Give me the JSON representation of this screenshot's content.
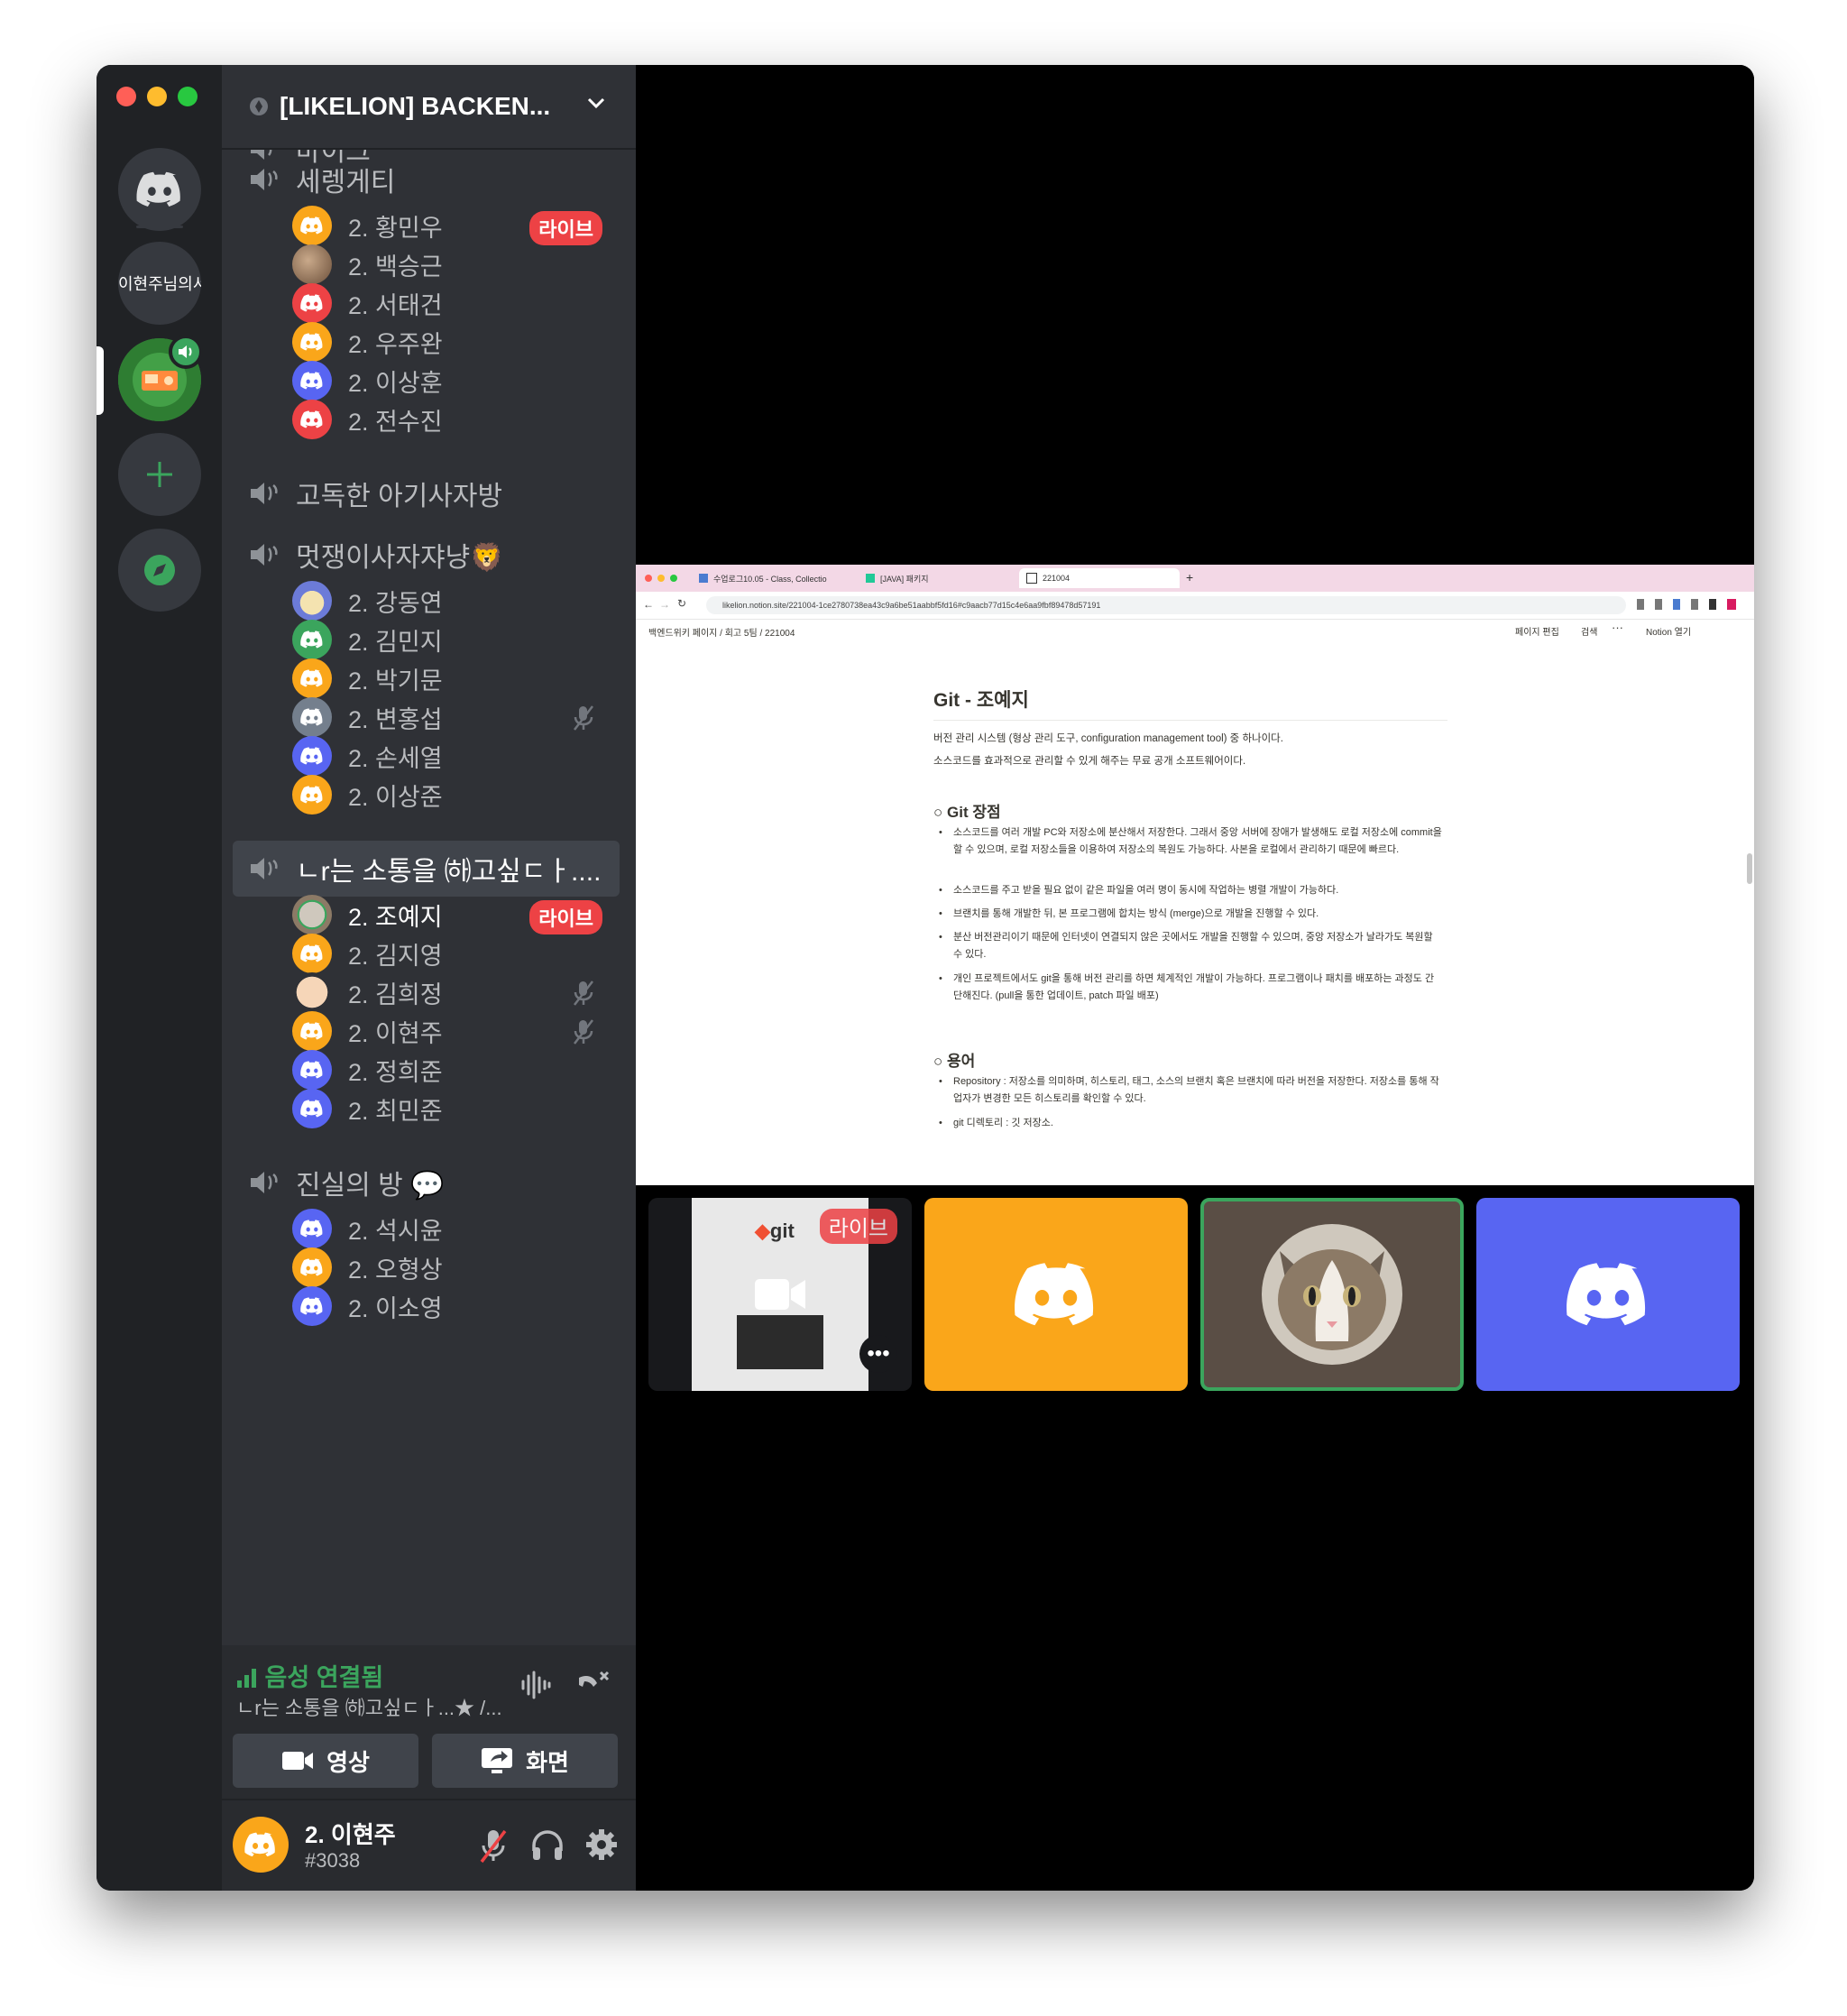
{
  "guild": {
    "name": "[LIKELION] BACKEN...",
    "partial_channel": "마이크"
  },
  "rail": {
    "server_label": "이현주님의서"
  },
  "channels": [
    {
      "name": "세렝게티",
      "users": [
        {
          "name": "2. 황민우",
          "avatar": "orange",
          "live": true,
          "muted": false
        },
        {
          "name": "2. 백승근",
          "avatar": "photo-brown",
          "live": false,
          "muted": false
        },
        {
          "name": "2. 서태건",
          "avatar": "red",
          "live": false,
          "muted": false
        },
        {
          "name": "2. 우주완",
          "avatar": "orange",
          "live": false,
          "muted": false
        },
        {
          "name": "2. 이상훈",
          "avatar": "blurple",
          "live": false,
          "muted": false
        },
        {
          "name": "2. 전수진",
          "avatar": "red",
          "live": false,
          "muted": false
        }
      ]
    },
    {
      "name": "고독한 아기사자방",
      "users": []
    },
    {
      "name": "멋쟁이사자쟈냥🦁",
      "users": [
        {
          "name": "2. 강동연",
          "avatar": "photo-bunny",
          "live": false,
          "muted": false
        },
        {
          "name": "2. 김민지",
          "avatar": "green",
          "live": false,
          "muted": false
        },
        {
          "name": "2. 박기문",
          "avatar": "orange",
          "live": false,
          "muted": false
        },
        {
          "name": "2. 변홍섭",
          "avatar": "grey",
          "live": false,
          "muted": true
        },
        {
          "name": "2. 손세열",
          "avatar": "blurple",
          "live": false,
          "muted": false
        },
        {
          "name": "2. 이상준",
          "avatar": "orange",
          "live": false,
          "muted": false
        }
      ]
    },
    {
      "name": "ㄴr는 소통을 ㈛고싶ㄷㅏ....",
      "active": true,
      "users": [
        {
          "name": "2. 조예지",
          "avatar": "photo-cat",
          "live": true,
          "muted": false,
          "me": true
        },
        {
          "name": "2. 김지영",
          "avatar": "orange",
          "live": false,
          "muted": false
        },
        {
          "name": "2. 김희정",
          "avatar": "photo-bear",
          "live": false,
          "muted": true
        },
        {
          "name": "2. 이현주",
          "avatar": "orange",
          "live": false,
          "muted": true
        },
        {
          "name": "2. 정희준",
          "avatar": "blurple",
          "live": false,
          "muted": false
        },
        {
          "name": "2. 최민준",
          "avatar": "blurple",
          "live": false,
          "muted": false
        }
      ]
    },
    {
      "name": "진실의 방 💬",
      "users": [
        {
          "name": "2. 석시윤",
          "avatar": "blurple",
          "live": false,
          "muted": false
        },
        {
          "name": "2. 오형상",
          "avatar": "orange",
          "live": false,
          "muted": false
        },
        {
          "name": "2. 이소영",
          "avatar": "blurple",
          "live": false,
          "muted": false
        }
      ]
    }
  ],
  "live_label": "라이브",
  "voice": {
    "status": "음성 연결됨",
    "channel": "ㄴr는 소통을 ㈛고싶ㄷㅏ...★ /...",
    "video_label": "영상",
    "screen_label": "화면"
  },
  "user_panel": {
    "name": "2. 이현주",
    "tag": "#3038"
  },
  "colors": {
    "orange": "#faa61a",
    "red": "#ed4245",
    "blurple": "#5865f2",
    "green": "#3ba55d",
    "grey": "#747f8d"
  },
  "browser": {
    "tabs": [
      "수업로그10.05 - Class, Collectio",
      "[JAVA] 패키지",
      "221004"
    ],
    "url": "likelion.notion.site/221004-1ce2780738ea43c9a6be51aabbf5fd16#c9aacb77d15c4e6aa9fbf89478d57191",
    "breadcrumb": [
      "백엔드위키 페이지",
      "회고 5팀",
      "221004"
    ],
    "actions": [
      "페이지 편집",
      "검색",
      "Notion 열기"
    ]
  },
  "doc": {
    "title": "Git - 조예지",
    "intro": [
      "버전 관리 시스템 (형상 관리 도구, configuration management tool) 중 하나이다.",
      "소스코드를 효과적으로 관리할 수 있게 해주는 무료 공개 소프트웨어이다."
    ],
    "section1": "Git 장점",
    "bullets1": [
      "소스코드를 여러 개발 PC와 저장소에 분산해서 저장한다. 그래서 중앙 서버에 장애가 발생해도 로컬 저장소에 commit을 할 수 있으며, 로컬 저장소들을 이용하여 저장소의 복원도 가능하다. 사본을 로컬에서 관리하기 때문에 빠르다.",
      "소스코드를 주고 받을 필요 없이 같은 파일을 여러 명이 동시에 작업하는 병렬 개발이 가능하다.",
      "브랜치를 통해 개발한 뒤, 본 프로그램에 합치는 방식 (merge)으로 개발을 진행할 수 있다.",
      "분산 버전관리이기 때문에 인터넷이 연결되지 않은 곳에서도 개발을 진행할 수 있으며, 중앙 저장소가 날라가도 복원할 수 있다.",
      "개인 프로젝트에서도 git을 통해 버전 관리를 하면 체계적인 개발이 가능하다. 프로그램이나 패치를 배포하는 과정도 간단해진다. (pull을 통한 업데이트, patch 파일 배포)"
    ],
    "section2": "용어",
    "bullets2": [
      "Repository : 저장소를 의미하며, 히스토리, 태그, 소스의 브랜치 혹은 브랜치에 따라 버전을 저장한다. 저장소를 통해 작업자가 변경한 모든 히스토리를 확인할 수 있다.",
      "git 디렉토리 : 깃 저장소."
    ]
  },
  "tiles": {
    "preview_logo_text": "git",
    "live_label": "라이브"
  }
}
